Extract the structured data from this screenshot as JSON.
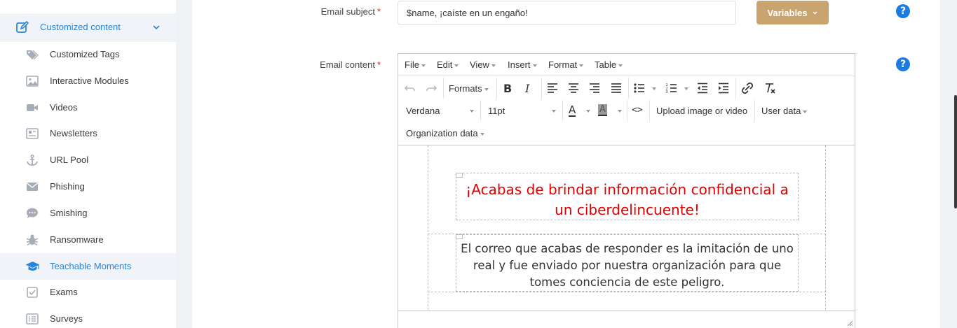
{
  "sidebar": {
    "parent": {
      "label": "Customized content",
      "icon": "edit-icon"
    },
    "items": [
      {
        "label": "Customized Tags",
        "icon": "tags-icon"
      },
      {
        "label": "Interactive Modules",
        "icon": "image-icon"
      },
      {
        "label": "Videos",
        "icon": "video-icon"
      },
      {
        "label": "Newsletters",
        "icon": "newspaper-icon"
      },
      {
        "label": "URL Pool",
        "icon": "anchor-icon"
      },
      {
        "label": "Phishing",
        "icon": "envelope-icon"
      },
      {
        "label": "Smishing",
        "icon": "sms-icon"
      },
      {
        "label": "Ransomware",
        "icon": "bug-icon"
      },
      {
        "label": "Teachable Moments",
        "icon": "graduation-cap-icon",
        "active": true
      },
      {
        "label": "Exams",
        "icon": "checkbox-icon"
      },
      {
        "label": "Surveys",
        "icon": "list-icon"
      }
    ]
  },
  "form": {
    "subject_label": "Email subject",
    "content_label": "Email content",
    "required_mark": "*",
    "subject_value": "$name, ¡caíste en un engaño!",
    "variables_label": "Variables",
    "help_glyph": "?"
  },
  "editor": {
    "menu": [
      "File",
      "Edit",
      "View",
      "Insert",
      "Format",
      "Table"
    ],
    "formats_label": "Formats",
    "font_family": "Verdana",
    "font_size": "11pt",
    "upload_label": "Upload image or video",
    "user_data_label": "User data",
    "org_data_label": "Organization data",
    "text_color_glyph": "A",
    "bg_color_glyph": "A",
    "bold_glyph": "B",
    "italic_glyph": "I",
    "code_glyph": "<>",
    "headline": "¡Acabas de brindar información confidencial a un ciberdelincuente!",
    "body": "El correo que acabas de responder es la imitación de uno real y fue enviado por nuestra organización para que tomes conciencia de este peligro.",
    "headline_color": "#e00000"
  },
  "colors": {
    "accent": "#2a86d8",
    "variables_button": "#c9a46e",
    "help": "#1a7be0"
  }
}
